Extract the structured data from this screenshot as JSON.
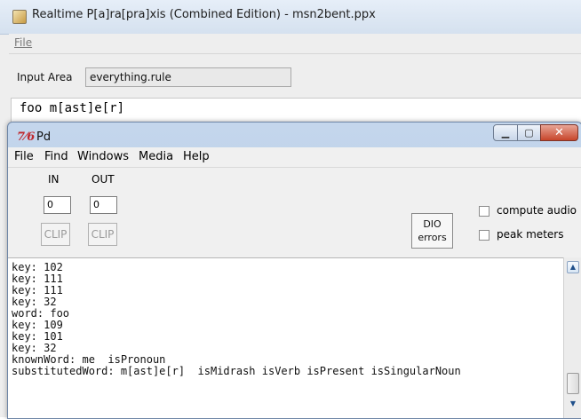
{
  "back_window": {
    "title": "Realtime P[a]ra[pra]xis (Combined Edition) - msn2bent.ppx",
    "menu": {
      "file": "File"
    },
    "input_area": {
      "label": "Input Area",
      "value": "everything.rule"
    },
    "code_text": "foo m[ast]e[r]"
  },
  "pd_window": {
    "icon_text": "7⁄6",
    "title": "Pd",
    "menu": [
      "File",
      "Find",
      "Windows",
      "Media",
      "Help"
    ],
    "in_label": "IN",
    "out_label": "OUT",
    "in_value": "0",
    "out_value": "0",
    "clip_in": "CLIP",
    "clip_out": "CLIP",
    "dio_line1": "DIO",
    "dio_line2": "errors",
    "compute_audio": "compute audio",
    "peak_meters": "peak meters",
    "console_lines": [
      "key: 102",
      "key: 111",
      "key: 111",
      "key: 32",
      "word: foo",
      "key: 109",
      "key: 101",
      "key: 32",
      "knownWord: me  isPronoun",
      "substitutedWord: m[ast]e[r]  isMidrash isVerb isPresent isSingularNoun"
    ]
  },
  "colors": {
    "pd_icon": "#c0282d",
    "title_bar": "#c4d6ec",
    "close_button": "#c7452b"
  }
}
